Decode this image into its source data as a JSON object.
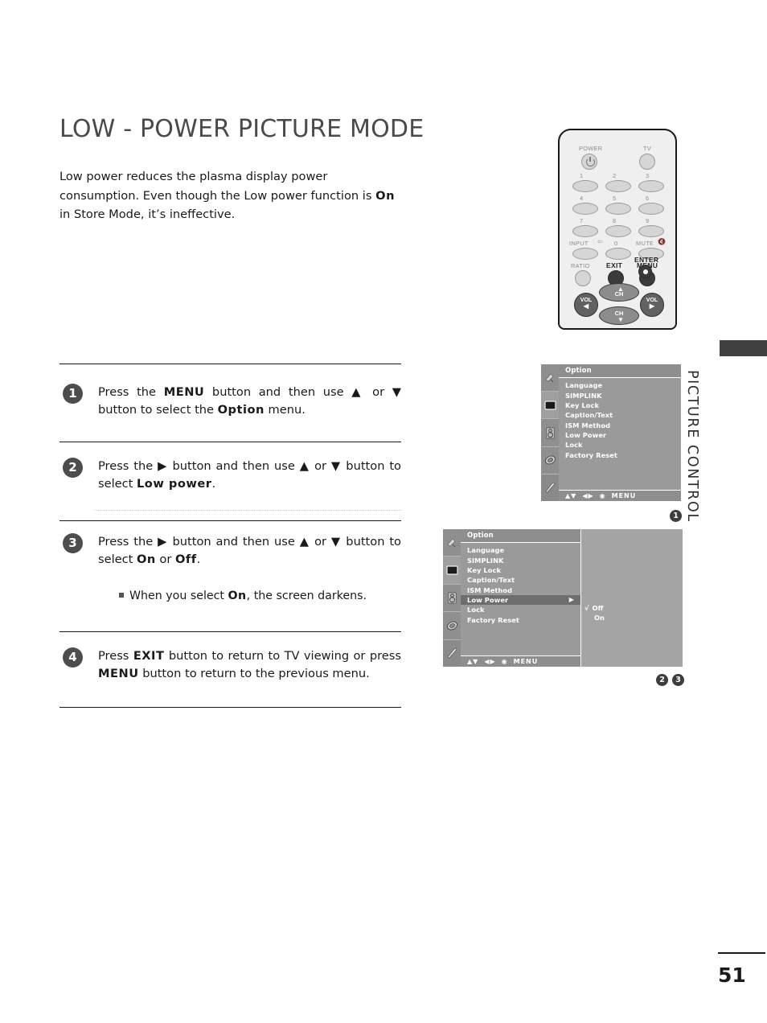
{
  "page": {
    "title": "LOW - POWER PICTURE MODE",
    "number": "51",
    "side_title": "PICTURE CONTROL"
  },
  "intro": {
    "line1": "Low power reduces the plasma display power consumption.",
    "line2_a": "Even though the Low power function is ",
    "line2_b": "On",
    "line2_c": " in Store Mode,",
    "line3": "it’s ineffective."
  },
  "steps": [
    {
      "num": "1",
      "parts": [
        {
          "t": "Press the ",
          "b": false
        },
        {
          "t": "MENU",
          "b": true
        },
        {
          "t": " button and then use ▲ or ▼ button to select the ",
          "b": false
        },
        {
          "t": "Option",
          "b": true
        },
        {
          "t": " menu.",
          "b": false
        }
      ]
    },
    {
      "num": "2",
      "parts": [
        {
          "t": "Press the ▶ button and then use ▲ or ▼ button to select ",
          "b": false
        },
        {
          "t": "Low power",
          "b": true
        },
        {
          "t": ".",
          "b": false
        }
      ]
    },
    {
      "num": "3",
      "parts": [
        {
          "t": "Press the ▶ button and then use ▲ or ▼ button to select ",
          "b": false
        },
        {
          "t": "On",
          "b": true
        },
        {
          "t": " or ",
          "b": false
        },
        {
          "t": "Off",
          "b": true
        },
        {
          "t": ".",
          "b": false
        }
      ]
    },
    {
      "num": "4",
      "parts": [
        {
          "t": "Press ",
          "b": false
        },
        {
          "t": "EXIT",
          "b": true
        },
        {
          "t": " button to return to TV viewing or press ",
          "b": false
        },
        {
          "t": "MENU",
          "b": true
        },
        {
          "t": " button to return to the previous menu.",
          "b": false
        }
      ]
    }
  ],
  "substep": {
    "a": "When you select ",
    "b": "On",
    "c": ", the screen darkens."
  },
  "remote": {
    "labels": {
      "power": "POWER",
      "tv": "TV",
      "input": "INPUT",
      "mute": "MUTE",
      "ratio": "RATIO",
      "exit": "EXIT",
      "menu": "MENU",
      "enter": "ENTER",
      "vol": "VOL",
      "ch": "CH"
    },
    "keys": [
      "1",
      "2",
      "3",
      "4",
      "5",
      "6",
      "7",
      "8",
      "9",
      "0"
    ]
  },
  "osd": {
    "title": "Option",
    "items": [
      "Language",
      "SIMPLINK",
      "Key Lock",
      "Caption/Text",
      "ISM Method",
      "Low Power",
      "Lock",
      "Factory Reset"
    ],
    "highlighted": "Low Power",
    "submenu_arrow": "▶",
    "navbar": {
      "updown": "▲▼",
      "leftright": "◀▶",
      "enter": "◉",
      "menu": "MENU"
    },
    "panel_options": [
      {
        "label": "Off",
        "check": "√"
      },
      {
        "label": "On",
        "check": ""
      }
    ],
    "rail_icons": [
      "antenna-icon",
      "picture-icon",
      "audio-icon",
      "time-icon",
      "option-icon"
    ]
  },
  "markers": {
    "m1": "1",
    "m2": "2",
    "m3": "3"
  },
  "colors": {
    "osd_bg": "#9a9a9a",
    "osd_title": "#8e8e8e",
    "osd_highlight": "#6e6e6e",
    "osd_panel": "#a4a4a4",
    "badge": "#4d4d4d",
    "tab": "#3f3f3f",
    "heading": "#4a4a4a"
  }
}
